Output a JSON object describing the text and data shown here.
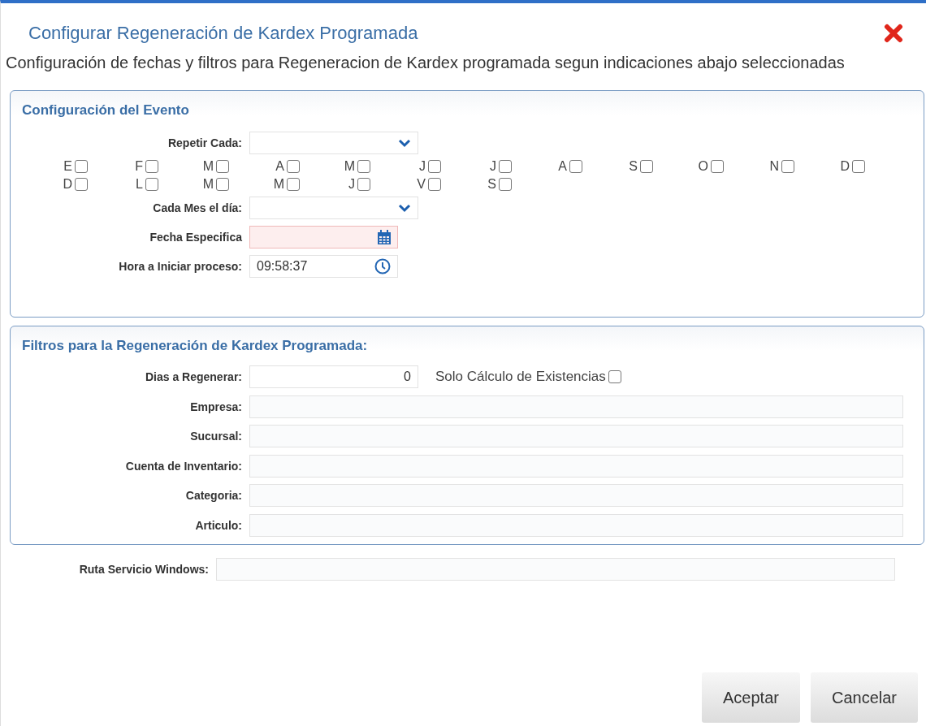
{
  "dialog": {
    "title": "Configurar Regeneración de Kardex Programada",
    "description": "Configuración de fechas y filtros para Regeneracion de Kardex programada segun indicaciones abajo seleccionadas"
  },
  "event_section": {
    "legend": "Configuración del Evento",
    "repeat": {
      "label": "Repetir Cada:",
      "kind": "select",
      "invalid": false
    },
    "months": [
      {
        "label": "E",
        "checked": false
      },
      {
        "label": "F",
        "checked": false
      },
      {
        "label": "M",
        "checked": false
      },
      {
        "label": "A",
        "checked": false
      },
      {
        "label": "M",
        "checked": false
      },
      {
        "label": "J",
        "checked": false
      },
      {
        "label": "J",
        "checked": false
      },
      {
        "label": "A",
        "checked": false
      },
      {
        "label": "S",
        "checked": false
      },
      {
        "label": "O",
        "checked": false
      },
      {
        "label": "N",
        "checked": false
      },
      {
        "label": "D",
        "checked": false
      }
    ],
    "weekdays": [
      {
        "label": "D",
        "checked": false
      },
      {
        "label": "L",
        "checked": false
      },
      {
        "label": "M",
        "checked": false
      },
      {
        "label": "M",
        "checked": false
      },
      {
        "label": "J",
        "checked": false
      },
      {
        "label": "V",
        "checked": false
      },
      {
        "label": "S",
        "checked": false
      }
    ],
    "fields": [
      {
        "label": "Cada Mes el día:",
        "kind": "select",
        "invalid": false
      },
      {
        "label": "Fecha Especifica",
        "kind": "date",
        "invalid": true
      },
      {
        "label": "Hora a Iniciar proceso:",
        "kind": "time",
        "value": "09:58:37",
        "invalid": false
      }
    ]
  },
  "filters_section": {
    "legend": "Filtros para la Regeneración de Kardex Programada:",
    "days": {
      "label": "Dias a Regenerar:",
      "value": "0"
    },
    "stock_only": {
      "label": "Solo Cálculo de Existencias",
      "checked": false
    },
    "fields": [
      {
        "label": "Empresa:"
      },
      {
        "label": "Sucursal:"
      },
      {
        "label": "Cuenta de Inventario:"
      },
      {
        "label": "Categoria:"
      },
      {
        "label": "Articulo:"
      }
    ]
  },
  "service_path": {
    "label": "Ruta Servicio Windows:"
  },
  "buttons": [
    {
      "label": "Aceptar"
    },
    {
      "label": "Cancelar"
    }
  ]
}
